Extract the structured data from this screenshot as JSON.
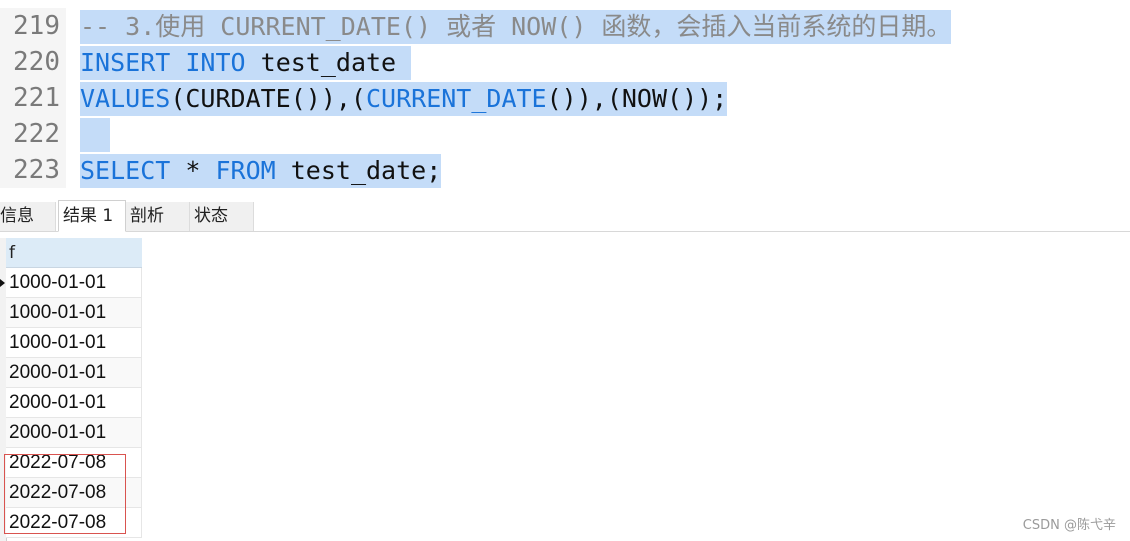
{
  "editor": {
    "lines": [
      {
        "number": "219",
        "segments": [
          {
            "text": "-- 3.使用 CURRENT_DATE() 或者 NOW() 函数，会插入当前系统的日期。",
            "cls": "cm"
          }
        ]
      },
      {
        "number": "220",
        "segments": [
          {
            "text": "INSERT",
            "cls": "kw"
          },
          {
            "text": " ",
            "cls": "plain"
          },
          {
            "text": "INTO",
            "cls": "kw"
          },
          {
            "text": " test_date ",
            "cls": "plain"
          }
        ]
      },
      {
        "number": "221",
        "segments": [
          {
            "text": "VALUES",
            "cls": "kw"
          },
          {
            "text": "(CURDATE()),(",
            "cls": "plain"
          },
          {
            "text": "CURRENT_DATE",
            "cls": "kw"
          },
          {
            "text": "()),(NOW());",
            "cls": "plain"
          }
        ]
      },
      {
        "number": "222",
        "segments": [
          {
            "text": "  ",
            "cls": "plain"
          }
        ]
      },
      {
        "number": "223",
        "segments": [
          {
            "text": "SELECT",
            "cls": "kw"
          },
          {
            "text": " * ",
            "cls": "plain"
          },
          {
            "text": "FROM",
            "cls": "kw"
          },
          {
            "text": " test_date;",
            "cls": "plain"
          }
        ]
      }
    ]
  },
  "tabs": [
    {
      "label": "信息",
      "active": false
    },
    {
      "label": "结果 1",
      "active": true
    },
    {
      "label": "剖析",
      "active": false
    },
    {
      "label": "状态",
      "active": false
    }
  ],
  "result": {
    "column": "f",
    "rows": [
      "1000-01-01",
      "1000-01-01",
      "1000-01-01",
      "2000-01-01",
      "2000-01-01",
      "2000-01-01",
      "2022-07-08",
      "2022-07-08",
      "2022-07-08"
    ]
  },
  "watermark": "CSDN @陈弋辛",
  "colors": {
    "keyword": "#1a73d9",
    "comment": "#8a8a8a",
    "selection": "#c4dcf8",
    "highlight_box": "#d9534f",
    "header_bg": "#dcebf7"
  }
}
